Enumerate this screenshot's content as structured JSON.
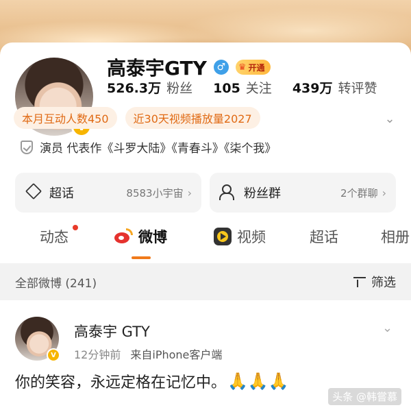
{
  "profile": {
    "name": "高泰宇GTY",
    "gender_symbol": "♂",
    "vip_label": "开通",
    "verified_badge": "V",
    "stats": [
      {
        "num": "526.3万",
        "label": "粉丝"
      },
      {
        "num": "105",
        "label": "关注"
      },
      {
        "num": "439万",
        "label": "转评赞"
      }
    ],
    "tags": [
      "本月互动人数450",
      "近30天视频播放量2027"
    ],
    "intro": "演员 代表作《斗罗大陆》《青春斗》《柒个我》",
    "features": [
      {
        "title": "超话",
        "value": "8583小宇宙",
        "icon": "diamond-icon"
      },
      {
        "title": "粉丝群",
        "value": "2个群聊",
        "icon": "people-icon"
      }
    ]
  },
  "tabs": [
    {
      "label": "动态"
    },
    {
      "label": "微博"
    },
    {
      "label": "视频"
    },
    {
      "label": "超话"
    },
    {
      "label": "相册"
    }
  ],
  "filter_bar": {
    "label": "全部微博 (241)",
    "filter_label": "筛选"
  },
  "post": {
    "name": "高泰宇 GTY",
    "time": "12分钟前",
    "source": "来自iPhone客户端",
    "text": "你的笑容，永远定格在记忆中。",
    "emoji": "🙏🙏🙏"
  },
  "watermark": "头条 @韩嘗慕",
  "colors": {
    "accent_orange": "#f07a1b",
    "verified_gold": "#f7b500",
    "notify_red": "#e83a2a"
  }
}
